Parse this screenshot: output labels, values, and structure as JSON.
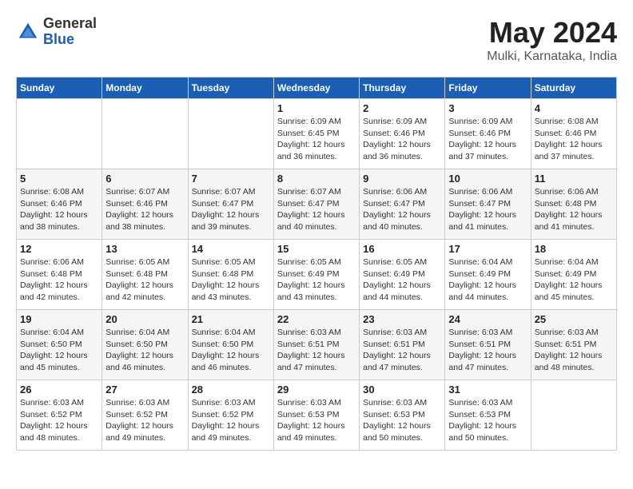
{
  "header": {
    "logo_general": "General",
    "logo_blue": "Blue",
    "month_year": "May 2024",
    "location": "Mulki, Karnataka, India"
  },
  "weekdays": [
    "Sunday",
    "Monday",
    "Tuesday",
    "Wednesday",
    "Thursday",
    "Friday",
    "Saturday"
  ],
  "weeks": [
    [
      {
        "day": "",
        "info": ""
      },
      {
        "day": "",
        "info": ""
      },
      {
        "day": "",
        "info": ""
      },
      {
        "day": "1",
        "info": "Sunrise: 6:09 AM\nSunset: 6:45 PM\nDaylight: 12 hours\nand 36 minutes."
      },
      {
        "day": "2",
        "info": "Sunrise: 6:09 AM\nSunset: 6:46 PM\nDaylight: 12 hours\nand 36 minutes."
      },
      {
        "day": "3",
        "info": "Sunrise: 6:09 AM\nSunset: 6:46 PM\nDaylight: 12 hours\nand 37 minutes."
      },
      {
        "day": "4",
        "info": "Sunrise: 6:08 AM\nSunset: 6:46 PM\nDaylight: 12 hours\nand 37 minutes."
      }
    ],
    [
      {
        "day": "5",
        "info": "Sunrise: 6:08 AM\nSunset: 6:46 PM\nDaylight: 12 hours\nand 38 minutes."
      },
      {
        "day": "6",
        "info": "Sunrise: 6:07 AM\nSunset: 6:46 PM\nDaylight: 12 hours\nand 38 minutes."
      },
      {
        "day": "7",
        "info": "Sunrise: 6:07 AM\nSunset: 6:47 PM\nDaylight: 12 hours\nand 39 minutes."
      },
      {
        "day": "8",
        "info": "Sunrise: 6:07 AM\nSunset: 6:47 PM\nDaylight: 12 hours\nand 40 minutes."
      },
      {
        "day": "9",
        "info": "Sunrise: 6:06 AM\nSunset: 6:47 PM\nDaylight: 12 hours\nand 40 minutes."
      },
      {
        "day": "10",
        "info": "Sunrise: 6:06 AM\nSunset: 6:47 PM\nDaylight: 12 hours\nand 41 minutes."
      },
      {
        "day": "11",
        "info": "Sunrise: 6:06 AM\nSunset: 6:48 PM\nDaylight: 12 hours\nand 41 minutes."
      }
    ],
    [
      {
        "day": "12",
        "info": "Sunrise: 6:06 AM\nSunset: 6:48 PM\nDaylight: 12 hours\nand 42 minutes."
      },
      {
        "day": "13",
        "info": "Sunrise: 6:05 AM\nSunset: 6:48 PM\nDaylight: 12 hours\nand 42 minutes."
      },
      {
        "day": "14",
        "info": "Sunrise: 6:05 AM\nSunset: 6:48 PM\nDaylight: 12 hours\nand 43 minutes."
      },
      {
        "day": "15",
        "info": "Sunrise: 6:05 AM\nSunset: 6:49 PM\nDaylight: 12 hours\nand 43 minutes."
      },
      {
        "day": "16",
        "info": "Sunrise: 6:05 AM\nSunset: 6:49 PM\nDaylight: 12 hours\nand 44 minutes."
      },
      {
        "day": "17",
        "info": "Sunrise: 6:04 AM\nSunset: 6:49 PM\nDaylight: 12 hours\nand 44 minutes."
      },
      {
        "day": "18",
        "info": "Sunrise: 6:04 AM\nSunset: 6:49 PM\nDaylight: 12 hours\nand 45 minutes."
      }
    ],
    [
      {
        "day": "19",
        "info": "Sunrise: 6:04 AM\nSunset: 6:50 PM\nDaylight: 12 hours\nand 45 minutes."
      },
      {
        "day": "20",
        "info": "Sunrise: 6:04 AM\nSunset: 6:50 PM\nDaylight: 12 hours\nand 46 minutes."
      },
      {
        "day": "21",
        "info": "Sunrise: 6:04 AM\nSunset: 6:50 PM\nDaylight: 12 hours\nand 46 minutes."
      },
      {
        "day": "22",
        "info": "Sunrise: 6:03 AM\nSunset: 6:51 PM\nDaylight: 12 hours\nand 47 minutes."
      },
      {
        "day": "23",
        "info": "Sunrise: 6:03 AM\nSunset: 6:51 PM\nDaylight: 12 hours\nand 47 minutes."
      },
      {
        "day": "24",
        "info": "Sunrise: 6:03 AM\nSunset: 6:51 PM\nDaylight: 12 hours\nand 47 minutes."
      },
      {
        "day": "25",
        "info": "Sunrise: 6:03 AM\nSunset: 6:51 PM\nDaylight: 12 hours\nand 48 minutes."
      }
    ],
    [
      {
        "day": "26",
        "info": "Sunrise: 6:03 AM\nSunset: 6:52 PM\nDaylight: 12 hours\nand 48 minutes."
      },
      {
        "day": "27",
        "info": "Sunrise: 6:03 AM\nSunset: 6:52 PM\nDaylight: 12 hours\nand 49 minutes."
      },
      {
        "day": "28",
        "info": "Sunrise: 6:03 AM\nSunset: 6:52 PM\nDaylight: 12 hours\nand 49 minutes."
      },
      {
        "day": "29",
        "info": "Sunrise: 6:03 AM\nSunset: 6:53 PM\nDaylight: 12 hours\nand 49 minutes."
      },
      {
        "day": "30",
        "info": "Sunrise: 6:03 AM\nSunset: 6:53 PM\nDaylight: 12 hours\nand 50 minutes."
      },
      {
        "day": "31",
        "info": "Sunrise: 6:03 AM\nSunset: 6:53 PM\nDaylight: 12 hours\nand 50 minutes."
      },
      {
        "day": "",
        "info": ""
      }
    ]
  ]
}
